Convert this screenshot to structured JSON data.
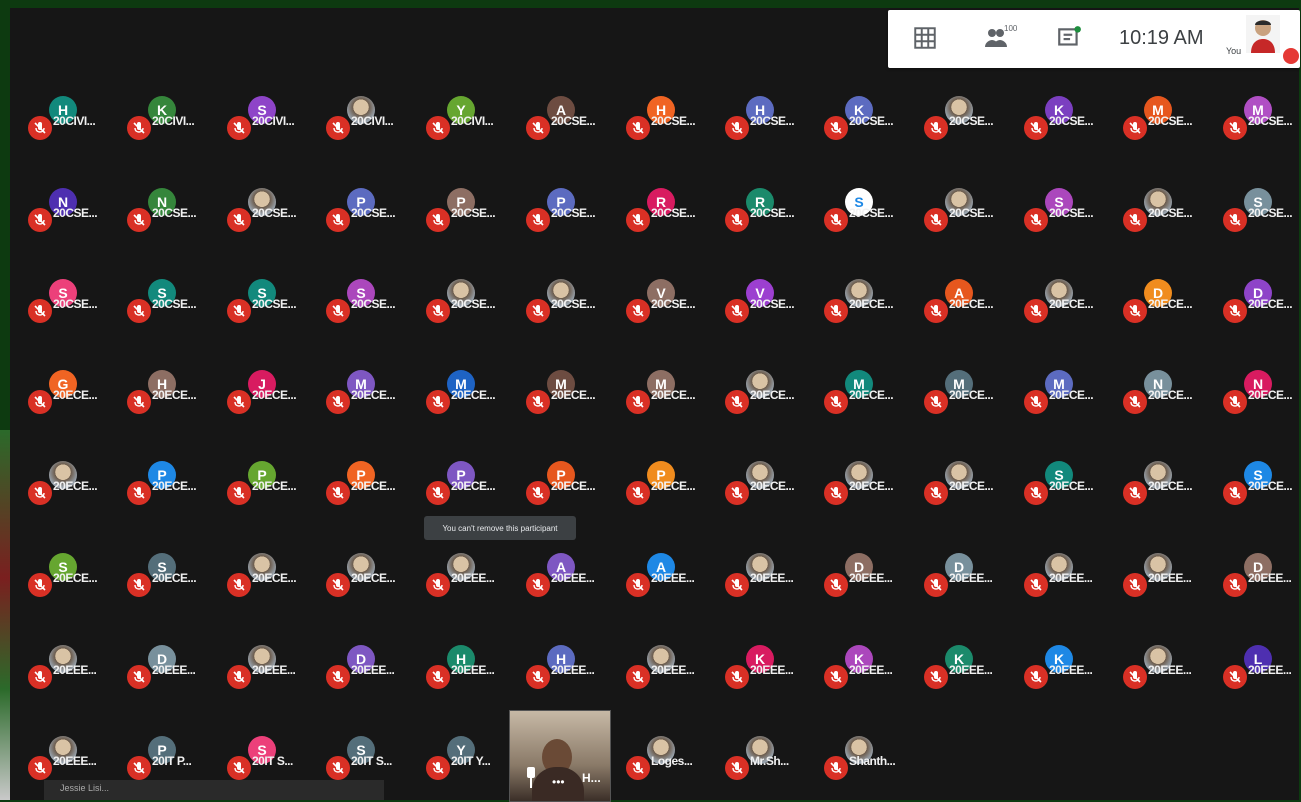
{
  "topbar": {
    "time": "10:19 AM",
    "you_label": "You",
    "people_count": "100",
    "icons": [
      "grid-view-icon",
      "people-icon",
      "chat-icon"
    ]
  },
  "tooltip": "You can't remove this participant",
  "bottom_strip_text": "Jessie Lisi...",
  "video_tile": {
    "name": "H..."
  },
  "colors": {
    "mic_off": "#d93025",
    "background": "#161616"
  },
  "participants": [
    {
      "name": "20CIVI...",
      "initial": "H",
      "color": "#12897c"
    },
    {
      "name": "20CIVI...",
      "initial": "K",
      "color": "#35863b"
    },
    {
      "name": "20CIVI...",
      "initial": "S",
      "color": "#8e44c8"
    },
    {
      "name": "20CIVI...",
      "initial": "",
      "photo": true
    },
    {
      "name": "20CIVI...",
      "initial": "Y",
      "color": "#66a630"
    },
    {
      "name": "20CSE...",
      "initial": "A",
      "color": "#6d4c41"
    },
    {
      "name": "20CSE...",
      "initial": "H",
      "color": "#f06423"
    },
    {
      "name": "20CSE...",
      "initial": "H",
      "color": "#5c6bc0"
    },
    {
      "name": "20CSE...",
      "initial": "K",
      "color": "#5c6bc0"
    },
    {
      "name": "20CSE...",
      "initial": "",
      "photo": true
    },
    {
      "name": "20CSE...",
      "initial": "K",
      "color": "#7b3fc0"
    },
    {
      "name": "20CSE...",
      "initial": "M",
      "color": "#e6571e"
    },
    {
      "name": "20CSE...",
      "initial": "M",
      "color": "#b04fc4"
    },
    {
      "name": "20CSE...",
      "initial": "N",
      "color": "#4e2fb0"
    },
    {
      "name": "20CSE...",
      "initial": "N",
      "color": "#35863b"
    },
    {
      "name": "20CSE...",
      "initial": "",
      "photo": true
    },
    {
      "name": "20CSE...",
      "initial": "P",
      "color": "#5c6bc0"
    },
    {
      "name": "20CSE...",
      "initial": "P",
      "color": "#8d6e63"
    },
    {
      "name": "20CSE...",
      "initial": "P",
      "color": "#5c6bc0"
    },
    {
      "name": "20CSE...",
      "initial": "R",
      "color": "#d81b60"
    },
    {
      "name": "20CSE...",
      "initial": "R",
      "color": "#1b8a6b"
    },
    {
      "name": "20CSE...",
      "initial": "S",
      "color": "#ffffff"
    },
    {
      "name": "20CSE...",
      "initial": "",
      "photo": true
    },
    {
      "name": "20CSE...",
      "initial": "S",
      "color": "#ab47bc"
    },
    {
      "name": "20CSE...",
      "initial": "",
      "photo": true
    },
    {
      "name": "20CSE...",
      "initial": "S",
      "color": "#78909c"
    },
    {
      "name": "20CSE...",
      "initial": "S",
      "color": "#ec407a"
    },
    {
      "name": "20CSE...",
      "initial": "S",
      "color": "#12897c"
    },
    {
      "name": "20CSE...",
      "initial": "S",
      "color": "#12897c"
    },
    {
      "name": "20CSE...",
      "initial": "S",
      "color": "#ab47bc"
    },
    {
      "name": "20CSE...",
      "initial": "",
      "photo": true
    },
    {
      "name": "20CSE...",
      "initial": "",
      "photo": true
    },
    {
      "name": "20CSE...",
      "initial": "V",
      "color": "#8d6e63"
    },
    {
      "name": "20CSE...",
      "initial": "V",
      "color": "#9c3fd0"
    },
    {
      "name": "20ECE...",
      "initial": "",
      "photo": true
    },
    {
      "name": "20ECE...",
      "initial": "A",
      "color": "#e6571e"
    },
    {
      "name": "20ECE...",
      "initial": "",
      "photo": true
    },
    {
      "name": "20ECE...",
      "initial": "D",
      "color": "#f08c1e"
    },
    {
      "name": "20ECE...",
      "initial": "D",
      "color": "#8e44c8"
    },
    {
      "name": "20ECE...",
      "initial": "G",
      "color": "#f06423"
    },
    {
      "name": "20ECE...",
      "initial": "H",
      "color": "#8d6e63"
    },
    {
      "name": "20ECE...",
      "initial": "J",
      "color": "#d81b60"
    },
    {
      "name": "20ECE...",
      "initial": "M",
      "color": "#7e57c2"
    },
    {
      "name": "20ECE...",
      "initial": "M",
      "color": "#1e63c4"
    },
    {
      "name": "20ECE...",
      "initial": "M",
      "color": "#6d4c41"
    },
    {
      "name": "20ECE...",
      "initial": "M",
      "color": "#8d6e63"
    },
    {
      "name": "20ECE...",
      "initial": "",
      "photo": true
    },
    {
      "name": "20ECE...",
      "initial": "M",
      "color": "#12897c"
    },
    {
      "name": "20ECE...",
      "initial": "M",
      "color": "#546e7a"
    },
    {
      "name": "20ECE...",
      "initial": "M",
      "color": "#5c6bc0"
    },
    {
      "name": "20ECE...",
      "initial": "N",
      "color": "#78909c"
    },
    {
      "name": "20ECE...",
      "initial": "N",
      "color": "#d81b60"
    },
    {
      "name": "20ECE...",
      "initial": "",
      "photo": true
    },
    {
      "name": "20ECE...",
      "initial": "P",
      "color": "#1e88e5"
    },
    {
      "name": "20ECE...",
      "initial": "P",
      "color": "#66a630"
    },
    {
      "name": "20ECE...",
      "initial": "P",
      "color": "#f06423"
    },
    {
      "name": "20ECE...",
      "initial": "P",
      "color": "#7e57c2"
    },
    {
      "name": "20ECE...",
      "initial": "P",
      "color": "#e6571e"
    },
    {
      "name": "20ECE...",
      "initial": "P",
      "color": "#f08c1e"
    },
    {
      "name": "20ECE...",
      "initial": "",
      "photo": true
    },
    {
      "name": "20ECE...",
      "initial": "",
      "photo": true
    },
    {
      "name": "20ECE...",
      "initial": "",
      "photo": true
    },
    {
      "name": "20ECE...",
      "initial": "S",
      "color": "#12897c"
    },
    {
      "name": "20ECE...",
      "initial": "",
      "photo": true
    },
    {
      "name": "20ECE...",
      "initial": "S",
      "color": "#1e88e5"
    },
    {
      "name": "20ECE...",
      "initial": "S",
      "color": "#66a630"
    },
    {
      "name": "20ECE...",
      "initial": "S",
      "color": "#546e7a"
    },
    {
      "name": "20ECE...",
      "initial": "",
      "photo": true
    },
    {
      "name": "20ECE...",
      "initial": "",
      "photo": true
    },
    {
      "name": "20EEE...",
      "initial": "",
      "photo": true
    },
    {
      "name": "20EEE...",
      "initial": "A",
      "color": "#7e57c2"
    },
    {
      "name": "20EEE...",
      "initial": "A",
      "color": "#1e88e5"
    },
    {
      "name": "20EEE...",
      "initial": "",
      "photo": true
    },
    {
      "name": "20EEE...",
      "initial": "D",
      "color": "#8d6e63"
    },
    {
      "name": "20EEE...",
      "initial": "D",
      "color": "#78909c"
    },
    {
      "name": "20EEE...",
      "initial": "",
      "photo": true
    },
    {
      "name": "20EEE...",
      "initial": "",
      "photo": true
    },
    {
      "name": "20EEE...",
      "initial": "D",
      "color": "#8d6e63"
    },
    {
      "name": "20EEE...",
      "initial": "",
      "photo": true
    },
    {
      "name": "20EEE...",
      "initial": "D",
      "color": "#78909c"
    },
    {
      "name": "20EEE...",
      "initial": "",
      "photo": true
    },
    {
      "name": "20EEE...",
      "initial": "D",
      "color": "#7e57c2"
    },
    {
      "name": "20EEE...",
      "initial": "H",
      "color": "#1b8a6b"
    },
    {
      "name": "20EEE...",
      "initial": "H",
      "color": "#5c6bc0"
    },
    {
      "name": "20EEE...",
      "initial": "",
      "photo": true
    },
    {
      "name": "20EEE...",
      "initial": "K",
      "color": "#d81b60"
    },
    {
      "name": "20EEE...",
      "initial": "K",
      "color": "#ab47bc"
    },
    {
      "name": "20EEE...",
      "initial": "K",
      "color": "#1b8a6b"
    },
    {
      "name": "20EEE...",
      "initial": "K",
      "color": "#1e88e5"
    },
    {
      "name": "20EEE...",
      "initial": "",
      "photo": true
    },
    {
      "name": "20EEE...",
      "initial": "L",
      "color": "#4e2fb0"
    },
    {
      "name": "20EEE...",
      "initial": "",
      "photo": true
    },
    {
      "name": "20IT P...",
      "initial": "P",
      "color": "#546e7a"
    },
    {
      "name": "20IT S...",
      "initial": "S",
      "color": "#ec407a"
    },
    {
      "name": "20IT S...",
      "initial": "S",
      "color": "#546e7a"
    },
    {
      "name": "20IT Y...",
      "initial": "Y",
      "color": "#546e7a"
    },
    {
      "name": "",
      "initial": "",
      "video": true
    },
    {
      "name": "Loges...",
      "initial": "",
      "photo": true
    },
    {
      "name": "Mr.Sh...",
      "initial": "",
      "photo": true
    },
    {
      "name": "Shanth...",
      "initial": "",
      "photo": true
    }
  ]
}
